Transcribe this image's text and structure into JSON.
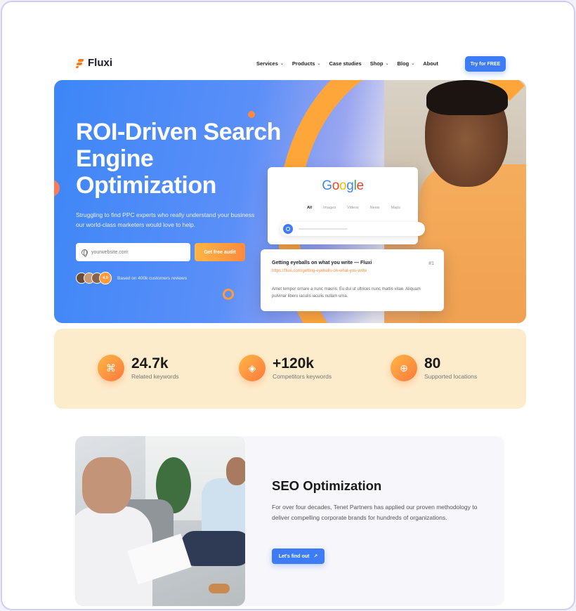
{
  "brand": {
    "name": "Fluxi",
    "accent": "#3d7cf5",
    "orange": "#ff8a3d"
  },
  "nav": {
    "items": [
      {
        "label": "Services",
        "dropdown": true
      },
      {
        "label": "Products",
        "dropdown": true
      },
      {
        "label": "Case studies",
        "dropdown": false
      },
      {
        "label": "Shop",
        "dropdown": true
      },
      {
        "label": "Blog",
        "dropdown": true
      },
      {
        "label": "About",
        "dropdown": false
      }
    ],
    "cta": "Try for FREE"
  },
  "hero": {
    "title": "ROI-Driven Search Engine Optimization",
    "subtitle": "Struggling to find PPC experts who really understand your business our world-class marketers would love to help.",
    "input_placeholder": "yourwebsite.com",
    "audit_button": "Get free audit",
    "rating": "4.9",
    "reviews_text": "Based on 400k customers reviews"
  },
  "search_mock": {
    "logo": "Google",
    "tabs": [
      "All",
      "Images",
      "Videos",
      "News",
      "Maps"
    ],
    "result": {
      "title": "Getting eyeballs on what you write — Fluxi",
      "url": "https://fluxi.com/getting-eyeballs-on-what-you-write",
      "rank": "#1",
      "description": "Amet tempor ornare a nunc mauris. Eu dui ut ultrices nunc mattis vitae. Aliquam pulvinar libero iaculis iaculis nullam uma."
    }
  },
  "stats": [
    {
      "icon": "keyword-icon",
      "value": "24.7k",
      "label": "Related keywords"
    },
    {
      "icon": "layers-icon",
      "value": "+120k",
      "label": "Competitors keywords"
    },
    {
      "icon": "location-target-icon",
      "value": "80",
      "label": "Supported locations"
    }
  ],
  "seo": {
    "title": "SEO Optimization",
    "text": "For over four decades, Tenet Partners has applied our proven methodology to deliver compelling corporate brands for hundreds of organizations.",
    "button": "Let's find out"
  }
}
